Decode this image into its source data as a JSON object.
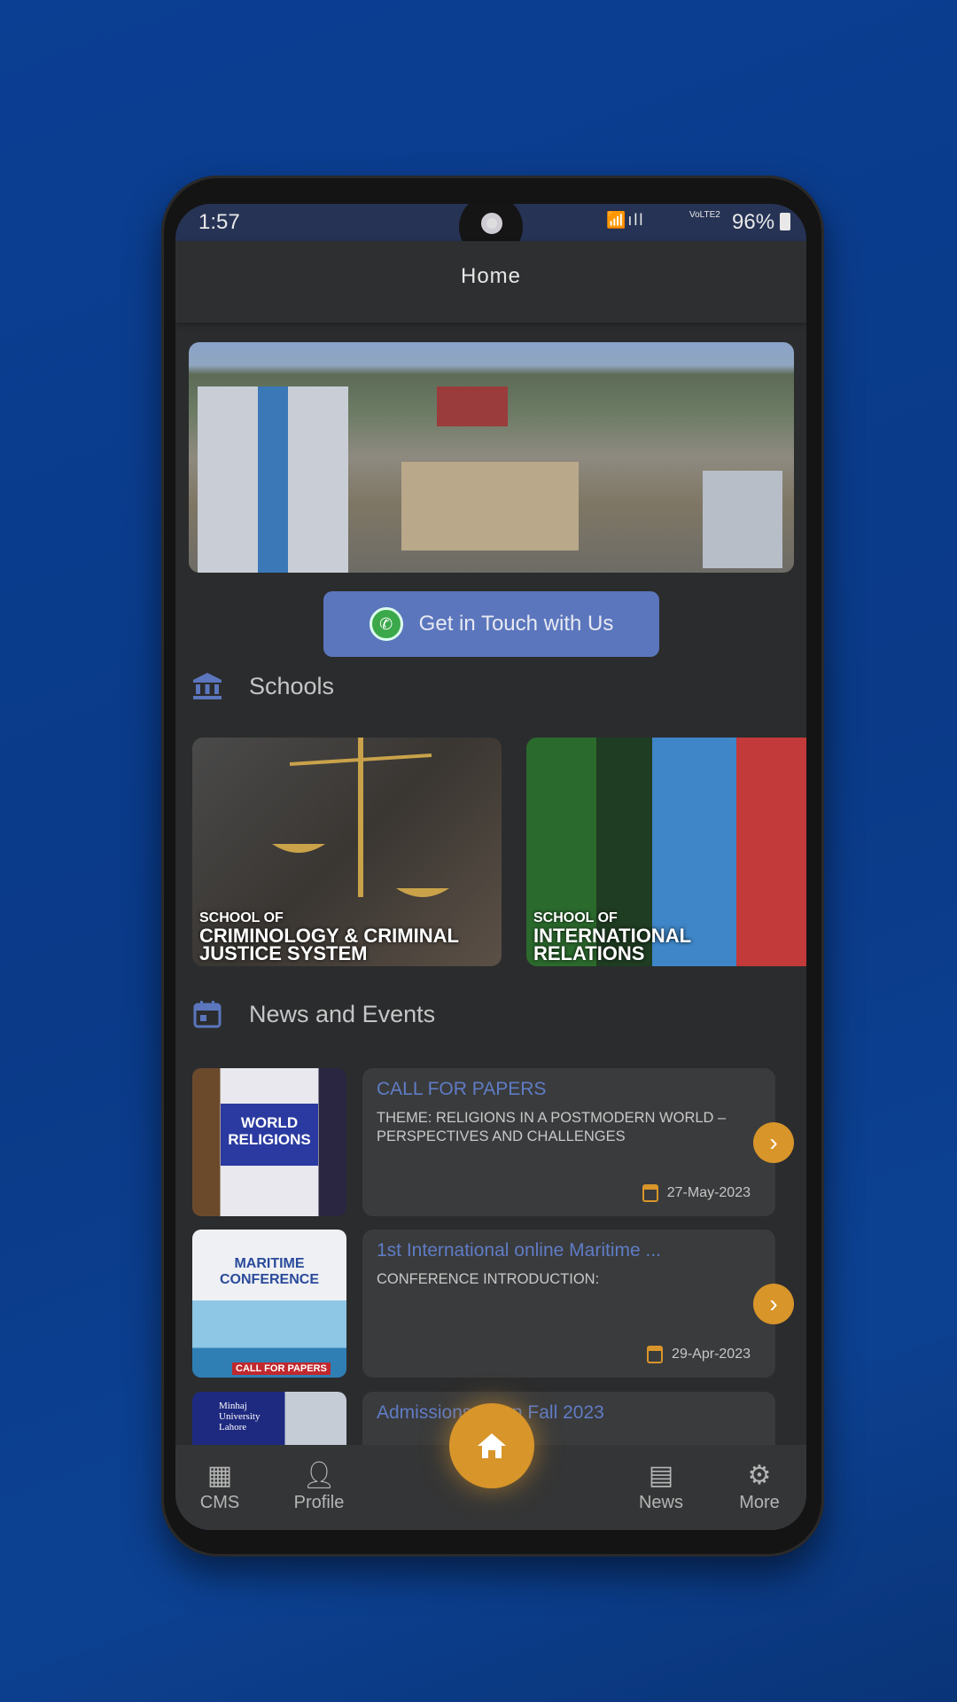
{
  "status_bar": {
    "time": "1:57",
    "battery": "96%",
    "network": "VoLTE2"
  },
  "header": {
    "title": "Home"
  },
  "contact_button": {
    "label": "Get in Touch with Us"
  },
  "schools": {
    "title": "Schools",
    "items": [
      {
        "prefix": "SCHOOL OF",
        "name": "CRIMINOLOGY & CRIMINAL JUSTICE SYSTEM"
      },
      {
        "prefix": "SCHOOL OF",
        "name": "INTERNATIONAL RELATIONS"
      }
    ]
  },
  "news": {
    "title": "News and Events",
    "items": [
      {
        "title": "CALL FOR PAPERS",
        "description": "THEME: RELIGIONS IN A POSTMODERN WORLD – PERSPECTIVES AND CHALLENGES",
        "date": "27-May-2023",
        "image_text": "WORLD RELIGIONS"
      },
      {
        "title": "1st International online Maritime ...",
        "description": "CONFERENCE INTRODUCTION:",
        "date": "29-Apr-2023",
        "image_text": "MARITIME CONFERENCE",
        "image_badge": "CALL FOR PAPERS"
      },
      {
        "title": "Admissions Open Fall 2023",
        "description": "",
        "date": "",
        "image_text": "Minhaj University Lahore"
      }
    ]
  },
  "bottom_nav": {
    "items": [
      {
        "label": "CMS",
        "icon": "dashboard-icon"
      },
      {
        "label": "Profile",
        "icon": "person-icon"
      },
      {
        "label": "News",
        "icon": "chat-icon"
      },
      {
        "label": "More",
        "icon": "gear-icon"
      }
    ],
    "fab_icon": "home-icon"
  },
  "colors": {
    "accent": "#5b76bd",
    "orange": "#d8952a",
    "background": "#0b3f93"
  }
}
